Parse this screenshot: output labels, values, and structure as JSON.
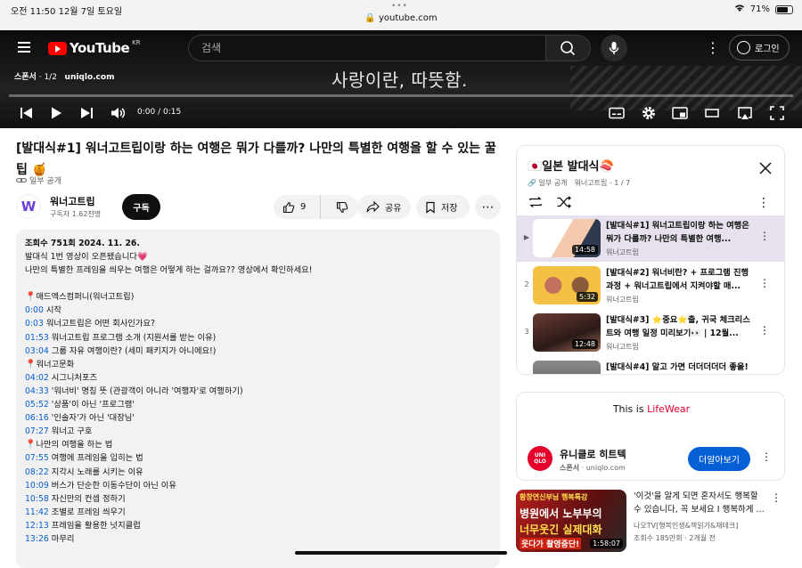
{
  "status_bar": {
    "time": "오전 11:50  12월 7일 토요일",
    "url": "youtube.com",
    "battery": "71%"
  },
  "header": {
    "logo_text": "YouTube",
    "logo_region": "KR",
    "search_placeholder": "검색",
    "login_label": "로그인"
  },
  "player": {
    "sponsor_label": "스폰서",
    "sponsor_count": "· 1/2",
    "sponsor_domain": "uniqlo.com",
    "caption": "사랑이란, 따뜻함.",
    "time": "0:00 / 0:15",
    "progress_fraction": 0
  },
  "video": {
    "title": "[발대식#1] 워너고트립이랑 하는 여행은 뭐가 다를까? 나만의 특별한 여행을 할 수 있는 꿀팁 🍯",
    "visibility": "일부 공개",
    "channel": "워너고트립",
    "subscribers": "구독자 1.62천명",
    "subscribe_label": "구독",
    "like_count": "9",
    "share_label": "공유",
    "save_label": "저장"
  },
  "description": {
    "meta": "조회수 751회  2024. 11. 26.",
    "intro": [
      "발대식 1번 영상이 오픈됐습니다💗",
      "나만의 특별한 프레임을 씌우는 여행은 어떻게 하는 걸까요?? 영상에서 확인하세요!"
    ],
    "sections": [
      {
        "heading": "매드엑스컴퍼니(워너고트립)",
        "chapters": [
          {
            "ts": "0:00",
            "label": "시작"
          },
          {
            "ts": "0:03",
            "label": "워너고트립은 어떤 회사인가요?"
          },
          {
            "ts": "01:53",
            "label": "워너고트립 프로그램 소개 (지원서를 받는 이유)"
          },
          {
            "ts": "03:04",
            "label": "그룹 자유 여행이란? (세미 패키지가 아니에요!)"
          }
        ]
      },
      {
        "heading": "워너고문화",
        "chapters": [
          {
            "ts": "04:02",
            "label": "시그니처포즈"
          },
          {
            "ts": "04:33",
            "label": "'워너비' 명칭 뜻 (관광객이 아니라 '여행자'로 여행하기)"
          },
          {
            "ts": "05:52",
            "label": "'상품'이 아닌 '프로그램'"
          },
          {
            "ts": "06:16",
            "label": "'인솔자'가 아닌 '대장님'"
          },
          {
            "ts": "07:27",
            "label": "워너고 구호"
          }
        ]
      },
      {
        "heading": "나만의 여행을 하는 법",
        "chapters": [
          {
            "ts": "07:55",
            "label": "여행에 프레임을 입히는 법"
          },
          {
            "ts": "08:22",
            "label": "지각시 노래를 시키는 이유"
          },
          {
            "ts": "10:09",
            "label": "버스가 단순한 이동수단이 아닌 이유"
          },
          {
            "ts": "10:58",
            "label": "자신만의 컨셉 정하기"
          },
          {
            "ts": "11:42",
            "label": "조별로 프레임 씌우기"
          },
          {
            "ts": "12:13",
            "label": "프레임을 활용한 넛지클럽"
          },
          {
            "ts": "13:26",
            "label": "마무리"
          }
        ]
      }
    ]
  },
  "playlist": {
    "title": "🇯🇵일본 발대식🍣",
    "visibility": "일부 공개",
    "channel": "워너고트립",
    "position": "- 1 / 7",
    "items": [
      {
        "index": "▶",
        "title": "[발대식#1] 워너고트립이랑 하는 여행은 뭐가 다를까? 나만의 특별한 여행...",
        "channel": "워너고트립",
        "duration": "14:58"
      },
      {
        "index": "2",
        "title": "[발대식#2] 워너비란? + 프로그램 진행 과정 + 워너고트립에서 지켜야할 매...",
        "channel": "워너고트립",
        "duration": "5:32"
      },
      {
        "index": "3",
        "title": "[발대식#3] ⭐중요⭐출, 귀국 체크리스트와 여행 일정 미리보기👀 | 12월...",
        "channel": "워너고트립",
        "duration": "12:48"
      },
      {
        "index": "4",
        "title": "[발대식#4] 알고 가면 더더더더더 좋을!",
        "channel": "",
        "duration": ""
      }
    ]
  },
  "ad": {
    "copy_prefix": "This is ",
    "copy_brand": "LifeWear",
    "advertiser": "유니클로 히트텍",
    "sponsor_label": "스폰서",
    "domain": "uniqlo.com",
    "cta_label": "더알아보기",
    "logo_text": "UNI QLO",
    "logo_color": "#e4002b"
  },
  "recommendation": {
    "thumb_line1": "황창연신부님 행복특강",
    "thumb_line2": "병원에서 노부부의",
    "thumb_line3": "너무웃긴 실제대화",
    "thumb_line4": "웃다가 촬영중단!",
    "duration": "1:58:07",
    "title": "'이것'을 알게 되면 혼자서도 행복할 수 있습니다, 꼭 보세요 I 행복하게 ...",
    "channel": "나오TV[행복인생&책읽기&재테크]",
    "stats": "조회수 185만회 · 2개월 전"
  },
  "colors": {
    "youtube_red": "#ff0000",
    "link_blue": "#065fd4",
    "playlist_active": "#e6e1ec"
  }
}
